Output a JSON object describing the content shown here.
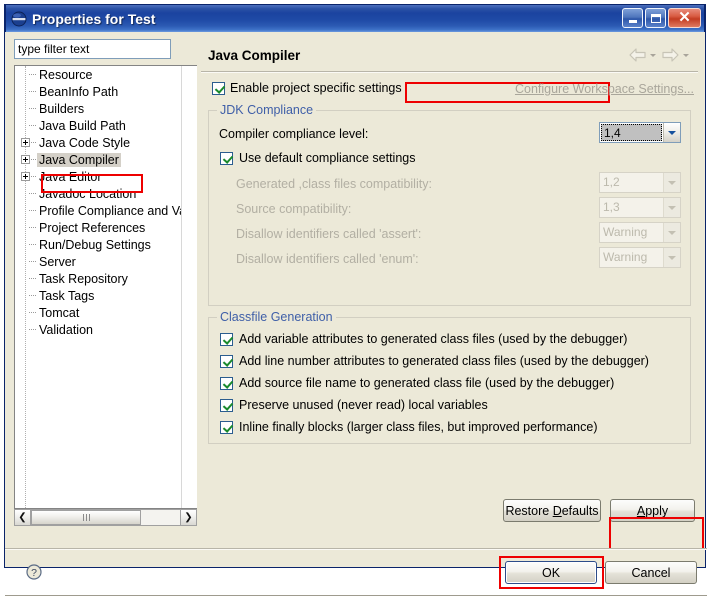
{
  "window": {
    "title": "Properties for Test",
    "app_icon": "eclipse-sphere-icon",
    "minimize_label": "Minimize",
    "maximize_label": "Maximize",
    "close_label": "Close"
  },
  "sidebar": {
    "filter": {
      "value": "type filter text",
      "placeholder": "type filter text"
    },
    "items": [
      {
        "label": "Resource",
        "expandable": false,
        "selected": false
      },
      {
        "label": "BeanInfo Path",
        "expandable": false,
        "selected": false
      },
      {
        "label": "Builders",
        "expandable": false,
        "selected": false
      },
      {
        "label": "Java Build Path",
        "expandable": false,
        "selected": false
      },
      {
        "label": "Java Code Style",
        "expandable": true,
        "selected": false
      },
      {
        "label": "Java Compiler",
        "expandable": true,
        "selected": true
      },
      {
        "label": "Java Editor",
        "expandable": true,
        "selected": false
      },
      {
        "label": "Javadoc Location",
        "expandable": false,
        "selected": false
      },
      {
        "label": "Profile Compliance and Va",
        "expandable": false,
        "selected": false
      },
      {
        "label": "Project References",
        "expandable": false,
        "selected": false
      },
      {
        "label": "Run/Debug Settings",
        "expandable": false,
        "selected": false
      },
      {
        "label": "Server",
        "expandable": false,
        "selected": false
      },
      {
        "label": "Task Repository",
        "expandable": false,
        "selected": false
      },
      {
        "label": "Task Tags",
        "expandable": false,
        "selected": false
      },
      {
        "label": "Tomcat",
        "expandable": false,
        "selected": false
      },
      {
        "label": "Validation",
        "expandable": false,
        "selected": false
      }
    ],
    "scroll_left_glyph": "❮",
    "scroll_right_glyph": "❯"
  },
  "page": {
    "title": "Java Compiler",
    "nav_back_icon": "arrow-left-icon",
    "nav_forward_icon": "arrow-right-icon",
    "enable_project_specific": {
      "label": "Enable project specific settings",
      "checked": true
    },
    "configure_workspace_link": "Configure Workspace Settings...",
    "jdk_compliance": {
      "title": "JDK Compliance",
      "compliance_level_label": "Compiler compliance level:",
      "compliance_level_value": "1,4",
      "use_default_label": "Use default compliance settings",
      "use_default_checked": true,
      "rows": [
        {
          "label": "Generated ,class files compatibility:",
          "value": "1,2",
          "disabled": true
        },
        {
          "label": "Source compatibility:",
          "value": "1,3",
          "disabled": true
        },
        {
          "label": "Disallow identifiers called 'assert':",
          "value": "Warning",
          "disabled": true
        },
        {
          "label": "Disallow identifiers called 'enum':",
          "value": "Warning",
          "disabled": true
        }
      ]
    },
    "classfile_generation": {
      "title": "Classfile Generation",
      "options": [
        {
          "label": "Add variable attributes to generated class files (used by the debugger)",
          "checked": true
        },
        {
          "label": "Add line number attributes to generated class files (used by the debugger)",
          "checked": true
        },
        {
          "label": "Add source file name to generated class file (used by the debugger)",
          "checked": true
        },
        {
          "label": "Preserve unused (never read) local variables",
          "checked": true
        },
        {
          "label": "Inline finally blocks (larger class files, but improved performance)",
          "checked": true
        }
      ]
    }
  },
  "buttons": {
    "restore_defaults": "Restore Defaults",
    "apply": "Apply",
    "ok": "OK",
    "cancel": "Cancel"
  },
  "footer": {
    "help_icon": "help-question-icon"
  },
  "annotations": {
    "highlight_color": "#ee0000",
    "boxes": [
      "enable-project-specific-settings",
      "java-compiler-tree-item",
      "compliance-level-combo",
      "apply-button",
      "ok-button"
    ]
  }
}
